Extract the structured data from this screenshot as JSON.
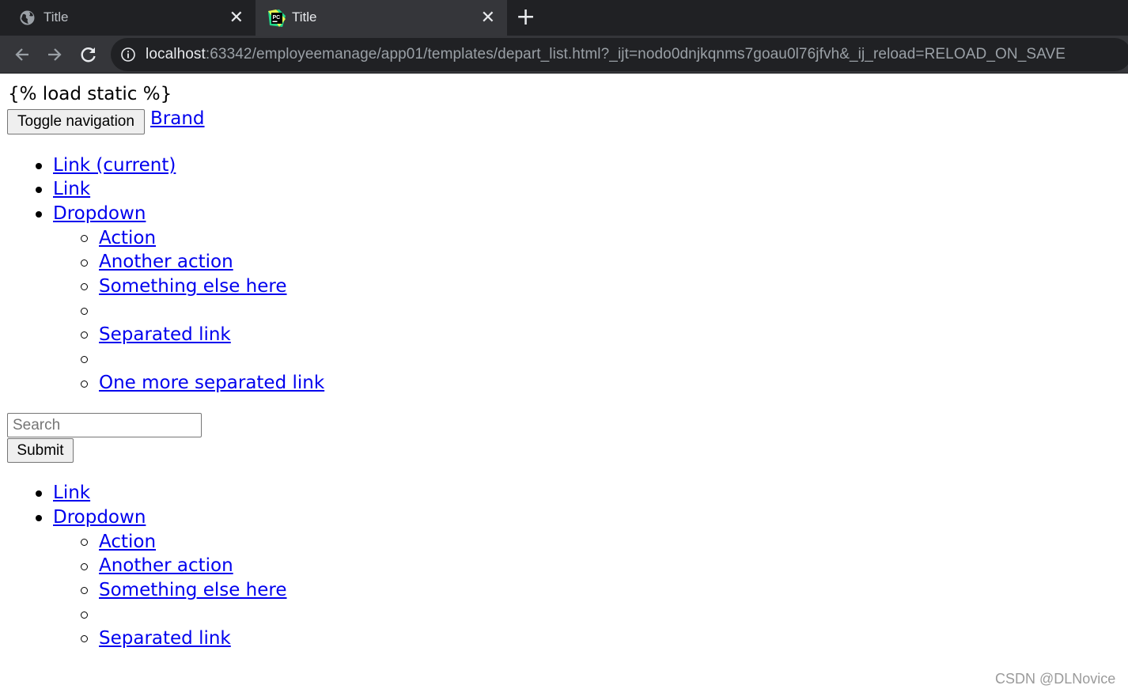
{
  "browser": {
    "tabs": [
      {
        "title": "Title",
        "close": "✕"
      },
      {
        "title": "Title",
        "close": "✕"
      }
    ],
    "new_tab": "+",
    "url_host": "localhost",
    "url_rest": ":63342/employeemanage/app01/templates/depart_list.html?_ijt=nodo0dnjkqnms7goau0l76jfvh&_ij_reload=RELOAD_ON_SAVE"
  },
  "page": {
    "template_text": "{% load static %}",
    "toggle_button": "Toggle navigation",
    "brand": "Brand",
    "nav1": {
      "items": [
        "Link (current)",
        "Link",
        "Dropdown"
      ],
      "dropdown": [
        "Action",
        "Another action",
        "Something else here",
        "",
        "Separated link",
        "",
        "One more separated link"
      ]
    },
    "search_placeholder": "Search",
    "submit_button": "Submit",
    "nav2": {
      "items": [
        "Link",
        "Dropdown"
      ],
      "dropdown": [
        "Action",
        "Another action",
        "Something else here",
        "",
        "Separated link"
      ]
    }
  },
  "watermark": "CSDN @DLNovice"
}
